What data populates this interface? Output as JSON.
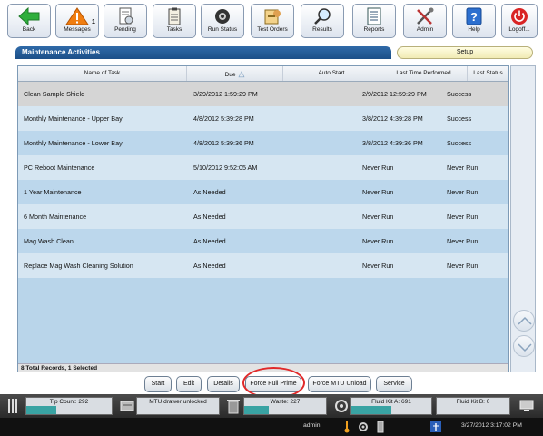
{
  "toolbar": {
    "back": "Back",
    "messages": "Messages",
    "messages_badge": "1",
    "pending": "Pending",
    "tasks": "Tasks",
    "run_status": "Run Status",
    "test_orders": "Test Orders",
    "results": "Results",
    "reports": "Reports",
    "admin": "Admin",
    "help": "Help",
    "logoff": "Logoff..."
  },
  "header": {
    "title": "Maintenance Activities",
    "setup_tab": "Setup"
  },
  "grid": {
    "columns": [
      "Name of Task",
      "Due",
      "Auto Start",
      "Last Time Performed",
      "Last Status"
    ],
    "rows": [
      {
        "name": "Clean Sample Shield",
        "due": "3/29/2012 1:59:29 PM",
        "auto": "",
        "last": "2/9/2012 12:59:29 PM",
        "status": "Success"
      },
      {
        "name": "Monthly Maintenance - Upper Bay",
        "due": "4/8/2012 5:39:28 PM",
        "auto": "",
        "last": "3/8/2012 4:39:28 PM",
        "status": "Success"
      },
      {
        "name": "Monthly Maintenance - Lower Bay",
        "due": "4/8/2012 5:39:36 PM",
        "auto": "",
        "last": "3/8/2012 4:39:36 PM",
        "status": "Success"
      },
      {
        "name": "PC Reboot Maintenance",
        "due": "5/10/2012 9:52:05 AM",
        "auto": "",
        "last": "Never Run",
        "status": "Never Run"
      },
      {
        "name": "1 Year Maintenance",
        "due": "As Needed",
        "auto": "",
        "last": "Never Run",
        "status": "Never Run"
      },
      {
        "name": "6 Month Maintenance",
        "due": "As Needed",
        "auto": "",
        "last": "Never Run",
        "status": "Never Run"
      },
      {
        "name": "Mag Wash Clean",
        "due": "As Needed",
        "auto": "",
        "last": "Never Run",
        "status": "Never Run"
      },
      {
        "name": "Replace Mag Wash Cleaning Solution",
        "due": "As Needed",
        "auto": "",
        "last": "Never Run",
        "status": "Never Run"
      }
    ],
    "footer": "8 Total Records, 1 Selected"
  },
  "actions": {
    "start": "Start",
    "edit": "Edit",
    "details": "Details",
    "force_full_prime": "Force Full Prime",
    "force_mtu_unload": "Force MTU Unload",
    "service": "Service"
  },
  "status": {
    "tip_count": "Tip Count: 292",
    "mtu_drawer": "MTU drawer unlocked",
    "waste": "Waste: 227",
    "fluid_kit_a": "Fluid Kit A: 691",
    "fluid_kit_b": "Fluid Kit B: 0",
    "tip_level": 0.35,
    "waste_level": 0.3,
    "fluid_a_level": 0.5,
    "user": "admin",
    "datetime": "3/27/2012 3:17:02 PM"
  },
  "colors": {
    "header_blue": "#1c4f88",
    "row_light": "#d6e6f2",
    "row_dark": "#bcd7ec",
    "selected_row": "#d5d5d5",
    "highlight_ring": "#e12a2a",
    "level_fill": "#39a3a3"
  }
}
